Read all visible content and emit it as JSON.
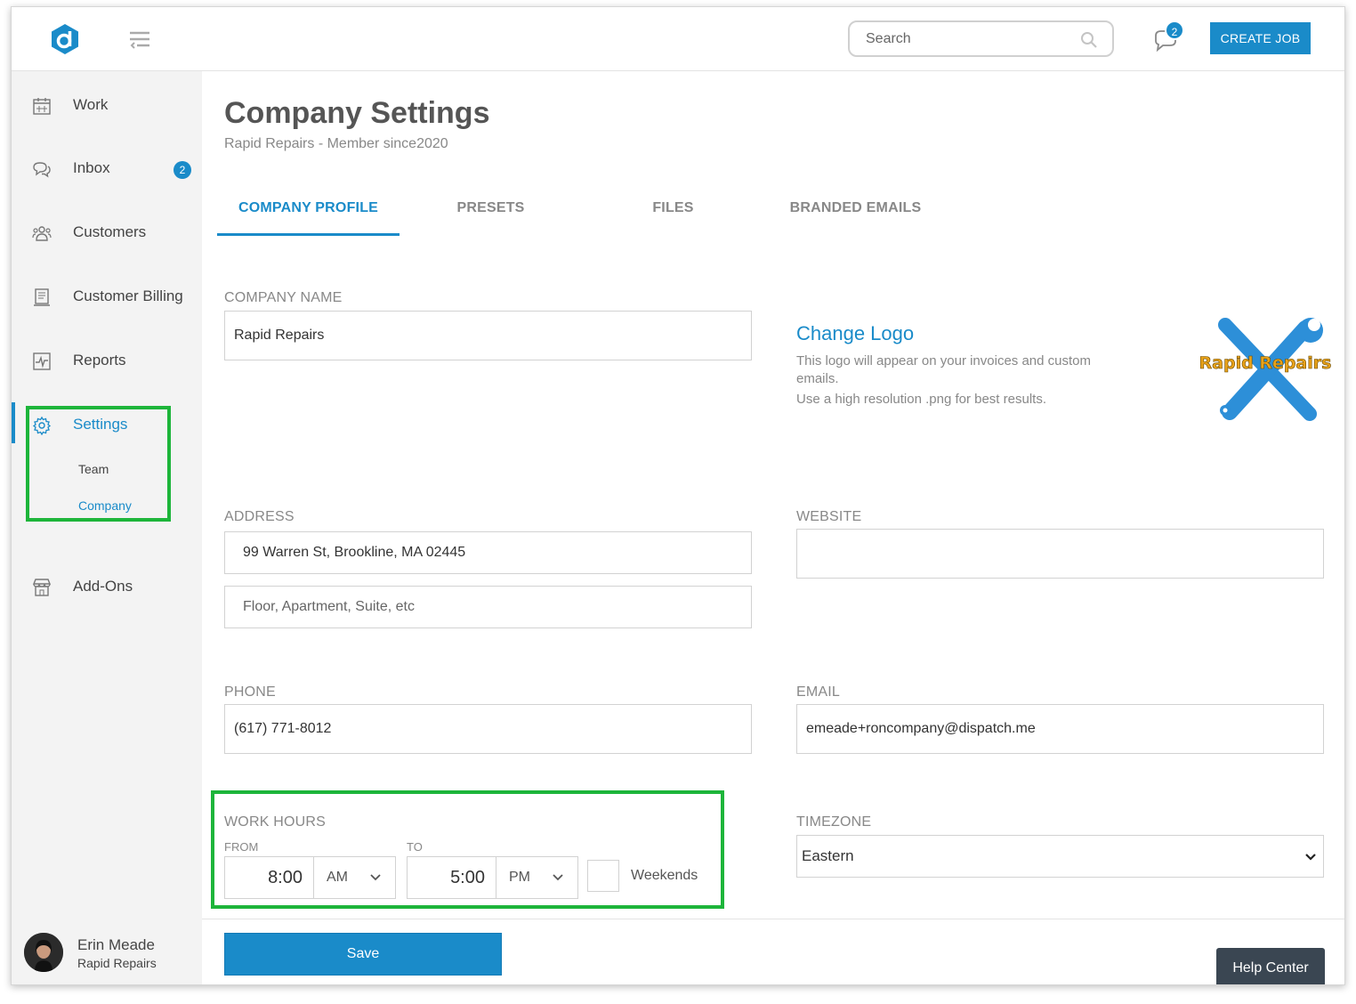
{
  "header": {
    "search_placeholder": "Search",
    "messages_count": "2",
    "create_job_label": "CREATE JOB"
  },
  "sidebar": {
    "items": [
      {
        "label": "Work",
        "icon": "calendar-icon"
      },
      {
        "label": "Inbox",
        "icon": "chat-bubbles-icon",
        "badge": "2"
      },
      {
        "label": "Customers",
        "icon": "people-icon"
      },
      {
        "label": "Customer Billing",
        "icon": "invoice-icon"
      },
      {
        "label": "Reports",
        "icon": "chart-icon"
      },
      {
        "label": "Settings",
        "icon": "gear-icon",
        "active": true
      },
      {
        "label": "Add-Ons",
        "icon": "store-icon"
      }
    ],
    "sub_items": [
      {
        "label": "Team"
      },
      {
        "label": "Company",
        "active": true
      }
    ],
    "user": {
      "name": "Erin Meade",
      "company": "Rapid Repairs"
    }
  },
  "page": {
    "title": "Company Settings",
    "subtitle": "Rapid Repairs - Member since2020",
    "tabs": [
      {
        "label": "COMPANY PROFILE",
        "active": true
      },
      {
        "label": "PRESETS"
      },
      {
        "label": "FILES"
      },
      {
        "label": "BRANDED EMAILS"
      }
    ]
  },
  "form": {
    "company_name_label": "COMPANY NAME",
    "company_name_value": "Rapid Repairs",
    "change_logo_label": "Change Logo",
    "logo_note_1": "This logo will appear on your invoices and custom emails.",
    "logo_note_2": "Use a high resolution .png for best results.",
    "logo_text": "Rapid Repairs",
    "address_label": "ADDRESS",
    "address_value": "99 Warren St, Brookline, MA 02445",
    "address2_placeholder": "Floor, Apartment, Suite, etc",
    "website_label": "WEBSITE",
    "website_value": "",
    "phone_label": "PHONE",
    "phone_value": "(617) 771-8012",
    "email_label": "EMAIL",
    "email_value": "emeade+roncompany@dispatch.me",
    "work_hours_label": "WORK HOURS",
    "from_label": "FROM",
    "to_label": "TO",
    "from_time": "8:00",
    "from_ampm": "AM",
    "to_time": "5:00",
    "to_ampm": "PM",
    "weekends_label": "Weekends",
    "weekends_checked": false,
    "timezone_label": "TIMEZONE",
    "timezone_value": "Eastern",
    "save_label": "Save"
  },
  "help_center_label": "Help Center",
  "colors": {
    "accent": "#1a8bc9",
    "highlight": "#1db53a",
    "sidebar_bg": "#f3f3f3",
    "help_bg": "#3a4652"
  }
}
